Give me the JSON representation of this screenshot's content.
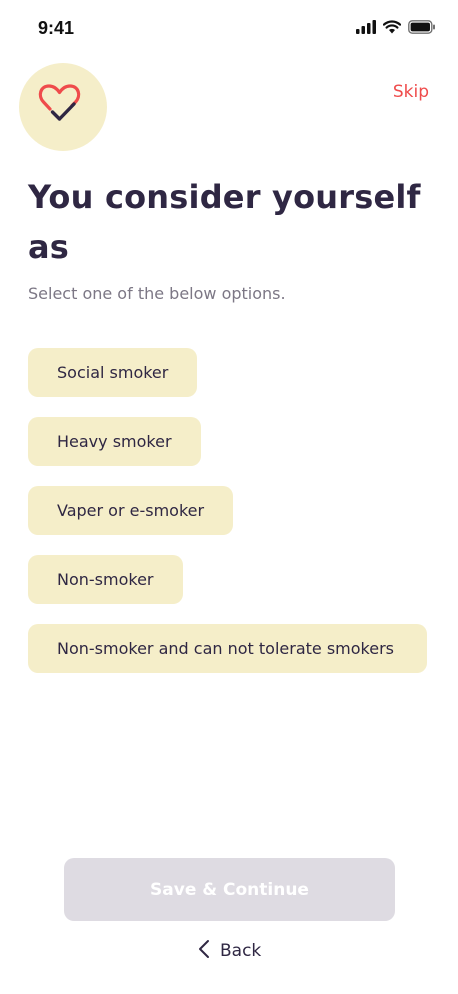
{
  "status_bar": {
    "time": "9:41",
    "icons": [
      "signal-icon",
      "wifi-icon",
      "battery-icon"
    ]
  },
  "header": {
    "logo_icon": "heart-check-icon",
    "skip_label": "Skip"
  },
  "question": {
    "title": "You consider yourself as",
    "subtitle": "Select one of the below options."
  },
  "options": [
    {
      "label": "Social smoker"
    },
    {
      "label": "Heavy smoker"
    },
    {
      "label": "Vaper or e-smoker"
    },
    {
      "label": "Non-smoker"
    },
    {
      "label": "Non-smoker and can not tolerate smokers"
    }
  ],
  "footer": {
    "save_label": "Save & Continue",
    "back_label": "Back",
    "back_icon": "chevron-left-icon"
  },
  "colors": {
    "accent": "#ef4b4b",
    "option_bg": "#f5eec9",
    "text_dark": "#2f2743",
    "disabled_button": "#dedbe2"
  }
}
